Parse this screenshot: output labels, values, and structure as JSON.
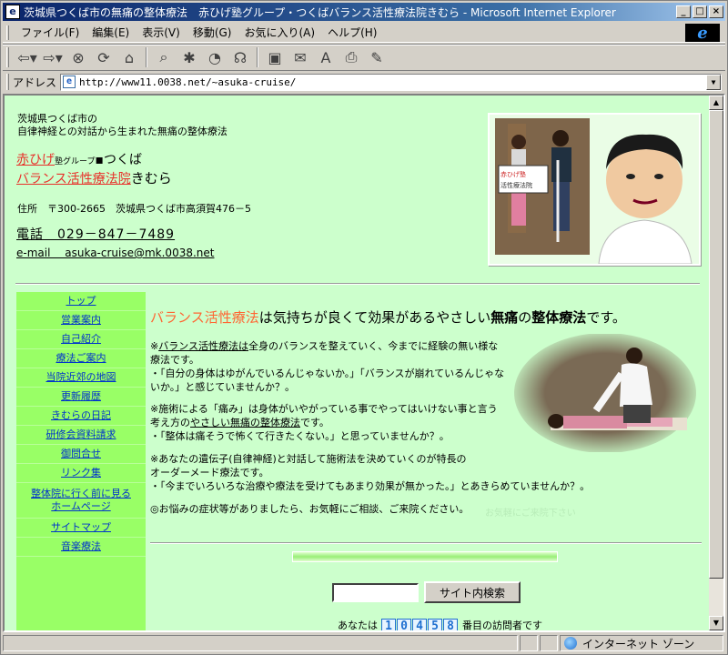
{
  "window": {
    "title": "茨城県つくば市の無痛の整体療法　赤ひげ塾グループ・つくばバランス活性療法院きむら - Microsoft Internet Explorer",
    "controls": [
      "_",
      "□",
      "×"
    ]
  },
  "menu": [
    "ファイル(F)",
    "編集(E)",
    "表示(V)",
    "移動(G)",
    "お気に入り(A)",
    "ヘルプ(H)"
  ],
  "address": {
    "label": "アドレス",
    "url": "http://www11.0038.net/~asuka-cruise/"
  },
  "page": {
    "tagline_1": "茨城県つくば市の",
    "tagline_2": "自律神経との対話から生まれた無痛の整体療法",
    "brand_group": "赤ひげ",
    "brand_group_small": "塾グループ",
    "brand_city": "つくば",
    "brand_clinic": "バランス活性療法院",
    "brand_name": "きむら",
    "address_line": "住所　〒300-2665　茨城県つくば市高須賀476－5",
    "phone": "電話　029－847－7489",
    "email": "e-mail　 asuka-cruise@mk.0038.net",
    "hero_sign": "赤ひげ塾グループ バランス活性療法院"
  },
  "nav": [
    "トップ",
    "営業案内",
    "自己紹介",
    "療法ご案内",
    "当院近郊の地図",
    "更新履歴",
    "きむらの日記",
    "研修会資料請求",
    "御問合せ",
    "リンク集",
    "整体院に行く前に見るホームページ",
    "サイトマップ",
    "音楽療法"
  ],
  "main": {
    "headline_orange": "バランス活性療法",
    "headline_mid": "は気持ちが良くて効果があるやさしい",
    "headline_bold1": "無痛",
    "headline_no": "の",
    "headline_bold2": "整体療法",
    "headline_end": "です。",
    "p1_prefix": "※",
    "p1_link": "バランス活性療法は",
    "p1_rest": "全身のバランスを整えていく、今までに経験の無い様な療法です。",
    "p1_line2": "・「自分の身体はゆがんでいるんじゃないか。」「バランスが崩れているんじゃないか。」と感じていませんか？。",
    "p2_line1": "※施術による「痛み」は身体がいやがっている事でやってはいけない事と言う考え方の",
    "p2_link": "やさしい無痛の整体療法",
    "p2_line1_end": "です。",
    "p2_line2": "・「整体は痛そうで怖くて行きたくない。」と思っていませんか？。",
    "p3_line1": "※あなたの遺伝子(自律神経)と対話して施術法を決めていくのが特長の",
    "p3_link": "オーダーメード療法",
    "p3_line1_end": "です。",
    "p3_line2": "・「今までいろいろな治療や療法を受けてもあまり効果が無かった。」とあきらめていませんか？。",
    "p4": "◎お悩みの症状等がありましたら、お気軽にご相談、ご来院ください。",
    "ghost_text": "お気軽にご来院下さい",
    "search_button": "サイト内検索",
    "search_value": "",
    "visitor_prefix": "あなたは",
    "counter_digits": [
      "1",
      "0",
      "4",
      "5",
      "8"
    ],
    "visitor_suffix": "番目の訪問者です"
  },
  "status": {
    "zone": "インターネット ゾーン"
  }
}
